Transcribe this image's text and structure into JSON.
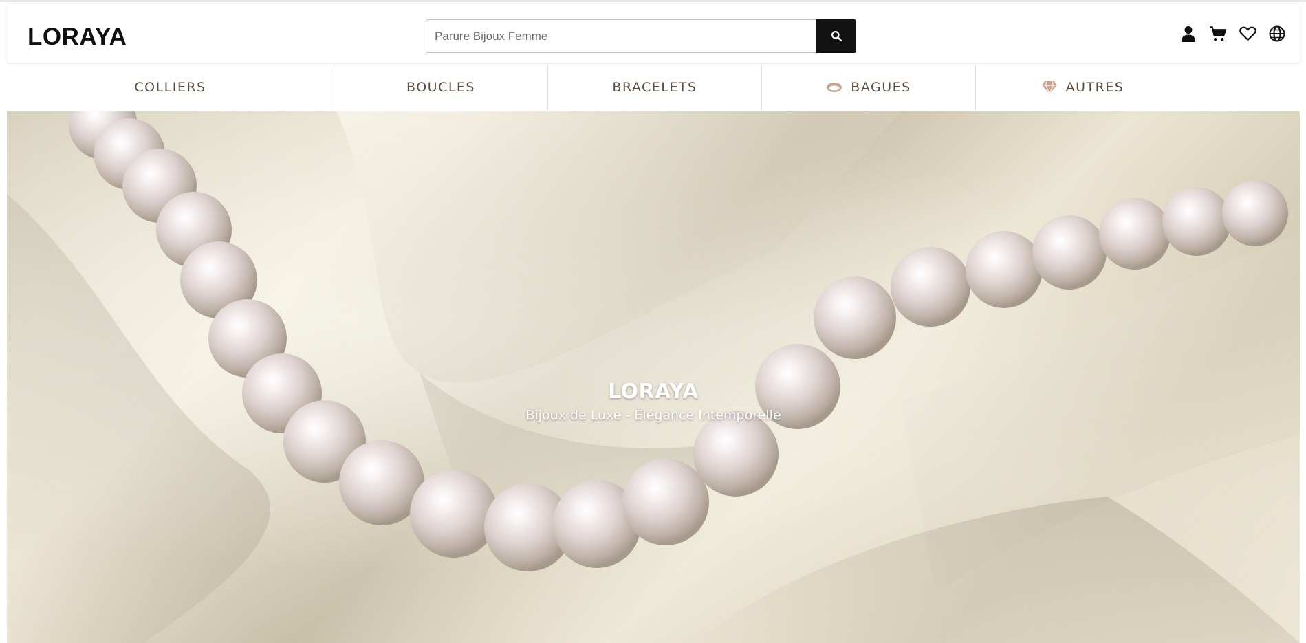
{
  "header": {
    "logo": "LORAYA",
    "search": {
      "placeholder": "Parure Bijoux Femme",
      "value": ""
    },
    "icons": [
      "user-icon",
      "cart-icon",
      "heart-icon",
      "globe-icon"
    ]
  },
  "nav": {
    "items": [
      {
        "label": "COLLIERS",
        "icon": null
      },
      {
        "label": "BOUCLES",
        "icon": null
      },
      {
        "label": "BRACELETS",
        "icon": null
      },
      {
        "label": "BAGUES",
        "icon": "ring-icon"
      },
      {
        "label": "AUTRES",
        "icon": "diamond-icon"
      }
    ]
  },
  "hero": {
    "title": "LORAYA",
    "subtitle": "Bijoux de Luxe - Élégance Intemporelle",
    "image": "pearl-necklace-on-satin"
  },
  "colors": {
    "nav_text": "#5b4a3e",
    "nav_icon": "#c9a48f",
    "search_button": "#121212"
  }
}
